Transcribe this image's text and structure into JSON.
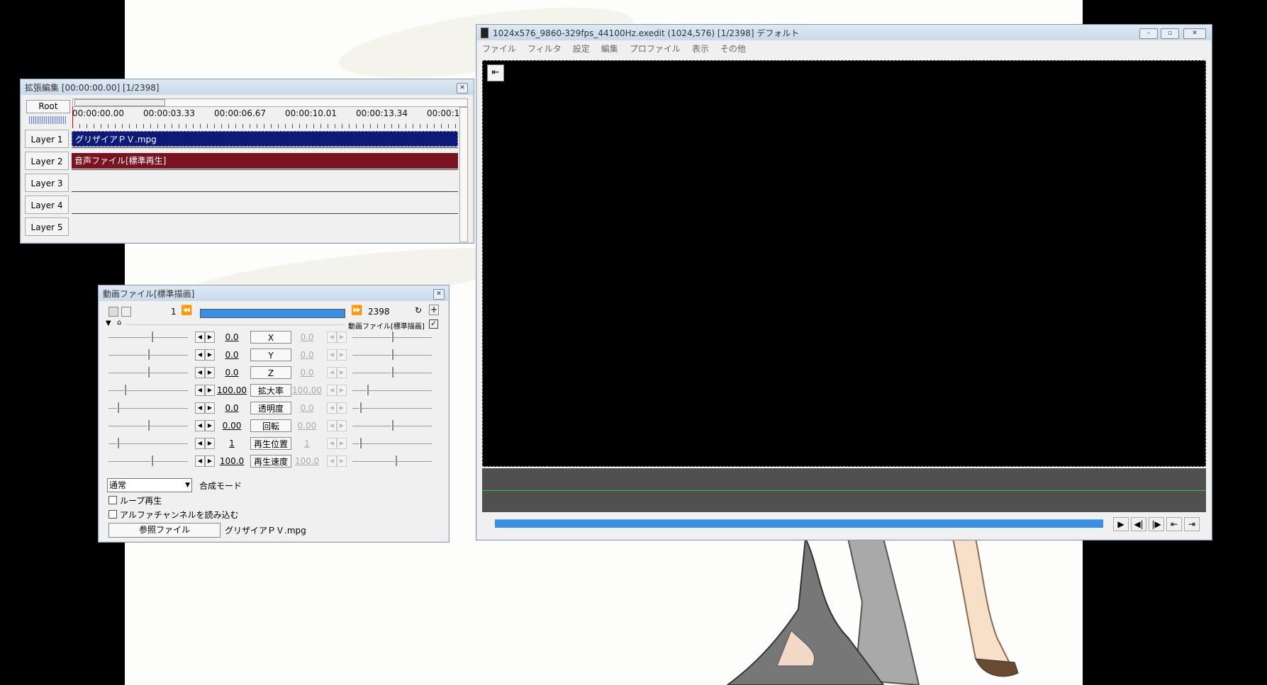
{
  "timeline": {
    "title": "拡張編集 [00:00:00.00] [1/2398]",
    "root_label": "Root",
    "ticks": [
      "00:00:00.00",
      "00:00:03.33",
      "00:00:06.67",
      "00:00:10.01",
      "00:00:13.34",
      "00:00:1"
    ],
    "layers": [
      "Layer 1",
      "Layer 2",
      "Layer 3",
      "Layer 4",
      "Layer 5"
    ],
    "clip1": "グリザイアＰＶ.mpg",
    "clip2": "音声ファイル[標準再生]",
    "clip1_color": "#0d1a7a",
    "clip2_color": "#7a1320"
  },
  "props": {
    "title": "動画ファイル[標準描画]",
    "frame_start": "1",
    "frame_end": "2398",
    "object_label": "動画ファイル[標準描画]",
    "params": [
      {
        "v1": "0.0",
        "name": "X",
        "v2": "0.0"
      },
      {
        "v1": "0.0",
        "name": "Y",
        "v2": "0.0"
      },
      {
        "v1": "0.0",
        "name": "Z",
        "v2": "0.0"
      },
      {
        "v1": "100.00",
        "name": "拡大率",
        "v2": "100.00"
      },
      {
        "v1": "0.0",
        "name": "透明度",
        "v2": "0.0"
      },
      {
        "v1": "0.00",
        "name": "回転",
        "v2": "0.00"
      },
      {
        "v1": "1",
        "name": "再生位置",
        "v2": "1"
      },
      {
        "v1": "100.0",
        "name": "再生速度",
        "v2": "100.0"
      }
    ],
    "blend_value": "通常",
    "blend_label": "合成モード",
    "loop_label": "ループ再生",
    "alpha_label": "アルファチャンネルを読み込む",
    "ref_button": "参照ファイル",
    "ref_file": "グリザイアＰＶ.mpg"
  },
  "main": {
    "title": "1024x576_9860-329fps_44100Hz.exedit (1024,576)  [1/2398]  デフォルト",
    "menu": [
      "ファイル",
      "フィルタ",
      "設定",
      "編集",
      "プロファイル",
      "表示",
      "その他"
    ],
    "accent": "#3a8ee6"
  }
}
